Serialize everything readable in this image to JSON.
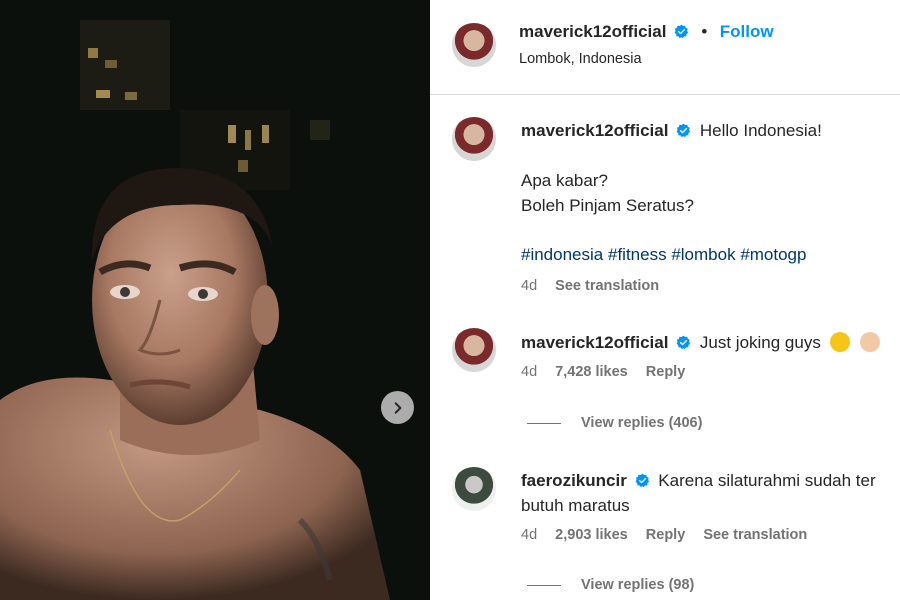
{
  "post": {
    "author": "maverick12official",
    "follow_label": "Follow",
    "location": "Lombok, Indonesia"
  },
  "caption": {
    "username": "maverick12official",
    "line1": "Hello Indonesia!",
    "line2": "Apa kabar?",
    "line3": "Boleh Pinjam Seratus?",
    "hashtags": [
      "#indonesia",
      "#fitness",
      "#lombok",
      "#motogp"
    ],
    "time": "4d",
    "see_translation": "See translation"
  },
  "comments": [
    {
      "username": "maverick12official",
      "text": "Just joking guys",
      "time": "4d",
      "likes": "7,428 likes",
      "reply": "Reply",
      "view_replies": "View replies (406)"
    },
    {
      "username": "faerozikuncir",
      "text_line1": "Karena silaturahmi sudah ter",
      "text_line2": "butuh maratus",
      "time": "4d",
      "likes": "2,903 likes",
      "reply": "Reply",
      "see_translation": "See translation",
      "view_replies": "View replies (98)"
    }
  ],
  "icons": {
    "verified": "verified-badge-icon",
    "next": "chevron-right-icon"
  },
  "colors": {
    "link_blue": "#0095f6",
    "hashtag": "#00376b",
    "muted": "#737373",
    "verified": "#0095f6"
  }
}
